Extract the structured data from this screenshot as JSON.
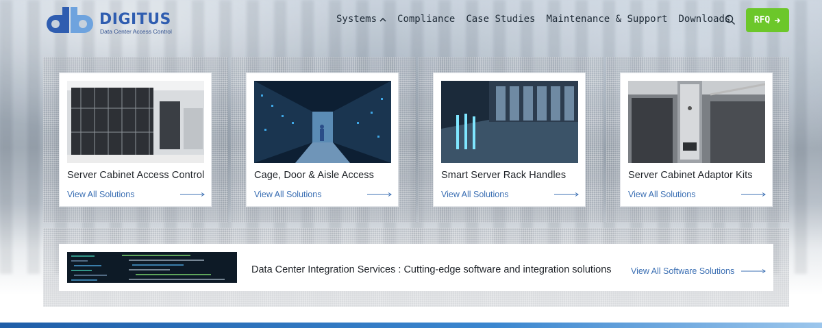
{
  "brand": {
    "name": "DIGITUS",
    "tagline": "Data Center Access Control",
    "colors": {
      "primary": "#2f5db0",
      "secondary": "#6ea3de",
      "rfq": "#6cc72a",
      "link": "#3b6fb3"
    }
  },
  "nav": {
    "items": [
      {
        "label": "Systems",
        "icon": "chevron-up-icon"
      },
      {
        "label": "Compliance"
      },
      {
        "label": "Case Studies"
      },
      {
        "label": "Maintenance & Support"
      },
      {
        "label": "Downloads"
      }
    ],
    "search_icon": "search-icon",
    "rfq_label": "RFQ",
    "rfq_icon": "arrow-right-icon"
  },
  "cards": [
    {
      "title": "Server Cabinet Access Control",
      "link": "View All Solutions"
    },
    {
      "title": "Cage, Door & Aisle Access",
      "link": "View All Solutions"
    },
    {
      "title": "Smart Server Rack Handles",
      "link": "View All Solutions"
    },
    {
      "title": "Server Cabinet Adaptor Kits",
      "link": "View All Solutions"
    }
  ],
  "integration": {
    "text": "Data Center Integration Services : Cutting-edge software and integration solutions",
    "link": "View All Software Solutions"
  }
}
